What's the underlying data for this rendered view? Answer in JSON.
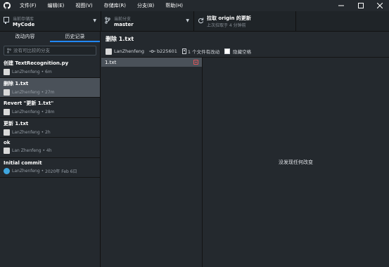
{
  "menu": {
    "items": [
      "文件(F)",
      "编辑(E)",
      "视图(V)",
      "存储库(R)",
      "分支(B)",
      "帮助(H)"
    ]
  },
  "toolbar": {
    "repo": {
      "label": "当前存储库",
      "value": "MyCode"
    },
    "branch": {
      "label": "当前分支",
      "value": "master"
    },
    "fetch": {
      "title": "拉取 origin 的更新",
      "subtitle": "上次拉取于 4 分钟前"
    }
  },
  "sidebar": {
    "tabs": [
      "改动内容",
      "历史记录"
    ],
    "search_placeholder": "没有可比较的分支",
    "commits": [
      {
        "title": "创建 TextRecognition.py",
        "author": "LanZhenfeng",
        "time": "6m",
        "selected": false
      },
      {
        "title": "删除 1.txt",
        "author": "LanZhenfeng",
        "time": "27m",
        "selected": true
      },
      {
        "title": "Revert \"更新 1.txt\"",
        "author": "LanZhenfeng",
        "time": "28m",
        "selected": false
      },
      {
        "title": "更新 1.txt",
        "author": "LanZhenfeng",
        "time": "2h",
        "selected": false
      },
      {
        "title": "ok",
        "author": "Lan Zhenfeng",
        "time": "4h",
        "selected": false
      },
      {
        "title": "Initial commit",
        "author": "LanZhenfeng",
        "time": "2020年 Feb 6日",
        "selected": false
      }
    ]
  },
  "detail": {
    "title": "删除 1.txt",
    "author": "LanZhenfeng",
    "sha": "b225601",
    "files_changed": "1 个文件有改动",
    "hide_whitespace": "隐藏空格",
    "files": [
      {
        "name": "1.txt",
        "status": "deleted"
      }
    ],
    "no_changes": "没发现任何改变"
  },
  "colors": {
    "accent": "#2188ff",
    "deleted": "#e0555a",
    "selected_row": "#4a5159"
  }
}
